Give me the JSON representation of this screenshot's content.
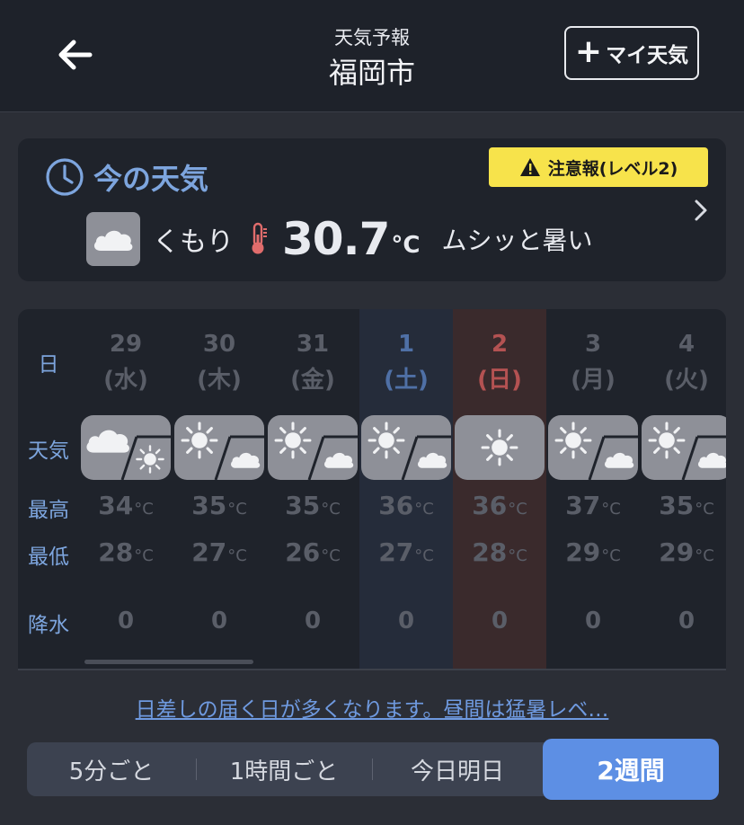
{
  "header": {
    "subtitle": "天気予報",
    "title": "福岡市",
    "my_weather_label": "マイ天気"
  },
  "now": {
    "title": "今の天気",
    "alert": "注意報(レベル2)",
    "condition": "くもり",
    "temp": "30.7",
    "unit": "°C",
    "feel": "ムシッと暑い"
  },
  "row_labels": {
    "day": "日",
    "weather": "天気",
    "max": "最高",
    "min": "最低",
    "rain": "降水"
  },
  "days": [
    {
      "num": "29",
      "wd": "(水)",
      "weather": "cloudy-then-sunny",
      "max": "34",
      "min": "28",
      "rain": "0"
    },
    {
      "num": "30",
      "wd": "(木)",
      "weather": "sunny-then-cloudy",
      "max": "35",
      "min": "27",
      "rain": "0"
    },
    {
      "num": "31",
      "wd": "(金)",
      "weather": "sunny-then-cloudy",
      "max": "35",
      "min": "26",
      "rain": "0"
    },
    {
      "num": "1",
      "wd": "(土)",
      "weather": "sunny-then-cloudy",
      "max": "36",
      "min": "27",
      "rain": "0"
    },
    {
      "num": "2",
      "wd": "(日)",
      "weather": "sunny",
      "max": "36",
      "min": "28",
      "rain": "0"
    },
    {
      "num": "3",
      "wd": "(月)",
      "weather": "sunny-then-cloudy",
      "max": "37",
      "min": "29",
      "rain": "0"
    },
    {
      "num": "4",
      "wd": "(火)",
      "weather": "sunny-then-cloudy",
      "max": "35",
      "min": "29",
      "rain": "0"
    }
  ],
  "temp_unit": "°C",
  "summary": "日差しの届く日が多くなります。昼間は猛暑レベ…",
  "tabs": [
    "5分ごと",
    "1時間ごと",
    "今日明日",
    "2週間"
  ],
  "active_tab": "2週間",
  "colors": {
    "accent_blue": "#7da5de",
    "alert_yellow": "#f7e34b",
    "active_tab": "#5d8fe4",
    "saturday": "#4f70a6",
    "sunday": "#b45252"
  }
}
